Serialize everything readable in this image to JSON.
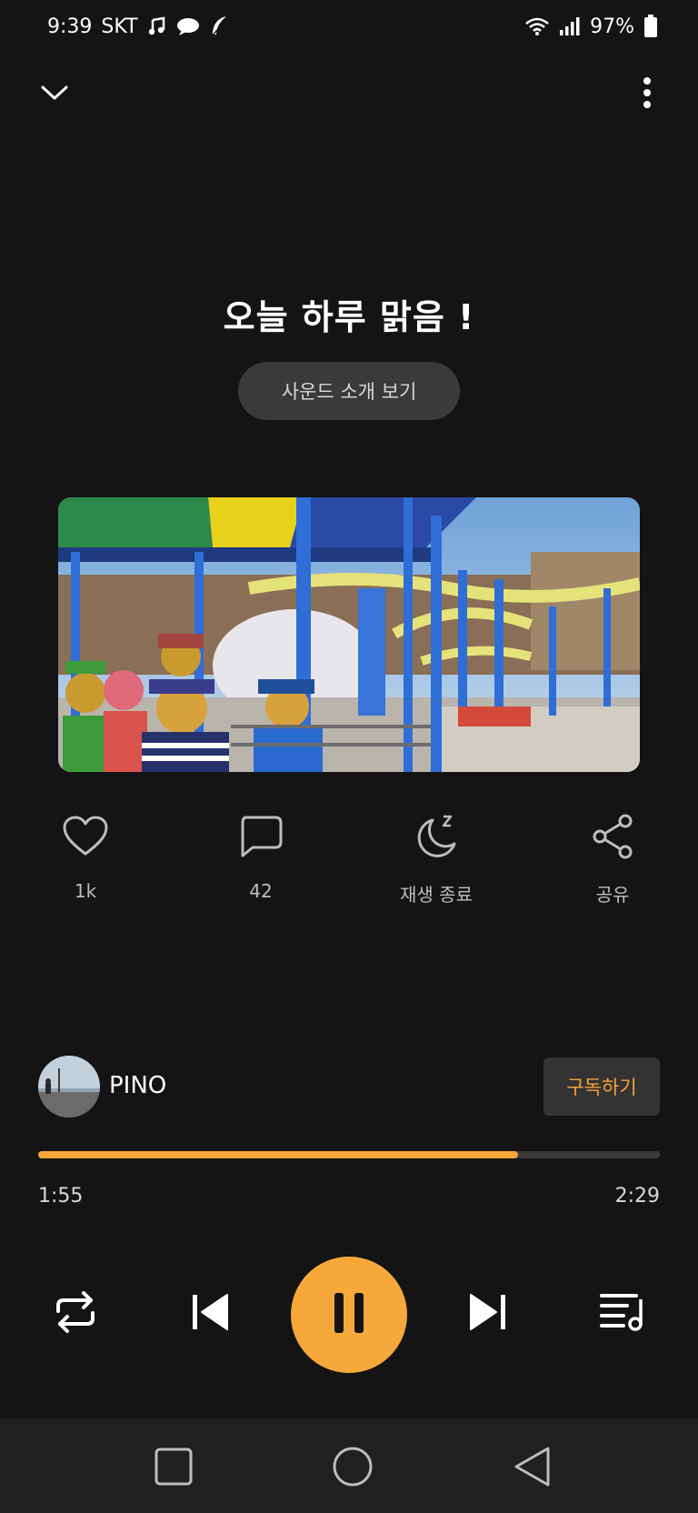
{
  "status_bar": {
    "time": "9:39",
    "carrier": "SKT",
    "battery": "97%",
    "icons": [
      "music-note-icon",
      "chat-bubble-icon",
      "feather-icon",
      "wifi-icon",
      "signal-icon",
      "battery-icon"
    ]
  },
  "track": {
    "title": "오늘 하루 맑음 !",
    "intro_button": "사운드 소개 보기"
  },
  "actions": [
    {
      "icon": "heart-icon",
      "label": "1k"
    },
    {
      "icon": "comment-icon",
      "label": "42"
    },
    {
      "icon": "sleep-moon-icon",
      "label": "재생 종료"
    },
    {
      "icon": "share-icon",
      "label": "공유"
    }
  ],
  "artist": {
    "name": "PINO",
    "subscribe_label": "구독하기"
  },
  "playback": {
    "current_time": "1:55",
    "total_time": "2:29",
    "progress_fraction": 0.772
  },
  "controls": [
    "repeat-icon",
    "previous-icon",
    "pause-icon",
    "next-icon",
    "playlist-icon"
  ],
  "nav_bar": [
    "recent-apps-icon",
    "home-icon",
    "back-icon"
  ],
  "colors": {
    "background": "#141414",
    "accent": "#f7a83b",
    "button_bg": "#3a3a3a"
  }
}
